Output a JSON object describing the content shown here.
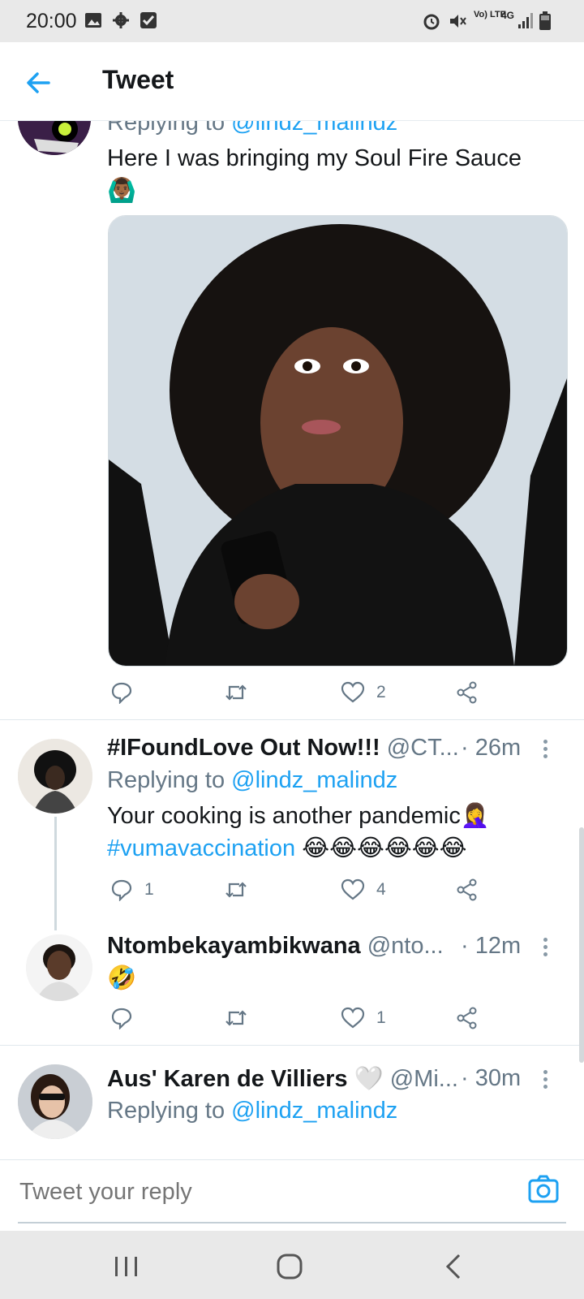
{
  "status_bar": {
    "time": "20:00",
    "network": "4G",
    "volte": "Vo) LTE"
  },
  "header": {
    "title": "Tweet"
  },
  "parent_tweet": {
    "replying_prefix": "Replying to ",
    "replying_handle": "@lindz_malindz",
    "text": "Here I was bringing my Soul Fire Sauce",
    "emoji": "🙆🏾‍♂️",
    "media_alt": "Woman with curly hair looking at phone in surprise",
    "actions": {
      "reply_count": "",
      "retweet_count": "",
      "like_count": "2"
    }
  },
  "replies": [
    {
      "name": "#IFoundLove Out Now!!!",
      "handle": "@CT...",
      "time": "· 26m",
      "replying_prefix": "Replying to ",
      "replying_handle": "@lindz_malindz",
      "text_line1": "Your cooking is another pandemic🤦‍♀️",
      "hashtag": "#vumavaccination",
      "text_emojis": " 😂😂😂😂😂😂",
      "reply_count": "1",
      "like_count": "4"
    },
    {
      "name": "Ntombekayambikwana",
      "handle": "@nto...",
      "time": "· 12m",
      "text": "🤣",
      "like_count": "1"
    },
    {
      "name": "Aus' Karen de Villiers",
      "name_emoji": "🤍",
      "handle": "@Mi...",
      "time": "· 30m",
      "replying_prefix": "Replying to ",
      "replying_handle": "@lindz_malindz"
    }
  ],
  "compose": {
    "placeholder": "Tweet your reply"
  },
  "colors": {
    "accent": "#1da1f2",
    "secondary_text": "#657786",
    "divider": "#e1e8ed"
  }
}
